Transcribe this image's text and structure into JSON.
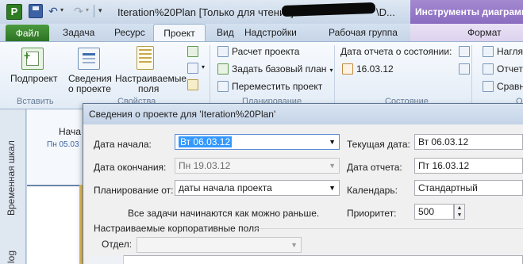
{
  "titlebar": {
    "app_icon_letter": "P",
    "window_title": "Iteration%20Plan [Только для чтения] <",
    "title_tail": "\\D...",
    "contextual_tools": "Инструменты диаграммы"
  },
  "tabs": {
    "file": "Файл",
    "task": "Задача",
    "resource": "Ресурс",
    "project": "Проект",
    "view": "Вид",
    "addins": "Надстройки",
    "team": "Рабочая группа",
    "format": "Формат"
  },
  "ribbon": {
    "subproject": "Подпроект",
    "project_info_1": "Сведения",
    "project_info_2": "о проекте",
    "custom_fields_1": "Настраиваемые",
    "custom_fields_2": "поля",
    "calculate_project": "Расчет проекта",
    "set_baseline": "Задать базовый план",
    "move_project": "Переместить проект",
    "status_date_label": "Дата отчета о состоянии:",
    "status_date_value": "16.03.12",
    "right_1": "Нагля",
    "right_2": "Отчет",
    "right_3": "Сравн",
    "group_insert": "Вставить",
    "group_properties": "Свойства",
    "group_schedule": "Планирование",
    "group_status": "Состояние",
    "group_right": "О"
  },
  "gantt": {
    "timeline_label": "Временная шкал",
    "start_label": "Нача",
    "start_date": "Пн 05.03",
    "gantt_label": "log"
  },
  "dialog": {
    "title": "Сведения о проекте для 'Iteration%20Plan'",
    "start_date_label": "Дата начала:",
    "start_date_value": "Вт 06.03.12",
    "finish_date_label": "Дата окончания:",
    "finish_date_value": "Пн 19.03.12",
    "schedule_from_label": "Планирование от:",
    "schedule_from_value": "даты начала проекта",
    "note": "Все задачи начинаются как можно раньше.",
    "current_date_label": "Текущая дата:",
    "current_date_value": "Вт 06.03.12",
    "status_date_label": "Дата отчета:",
    "status_date_value": "Пт 16.03.12",
    "calendar_label": "Календарь:",
    "calendar_value": "Стандартный",
    "priority_label": "Приоритет:",
    "priority_value": "500",
    "enterprise_fields_label": "Настраиваемые корпоративные поля",
    "department_label": "Отдел:",
    "department_value": ""
  }
}
